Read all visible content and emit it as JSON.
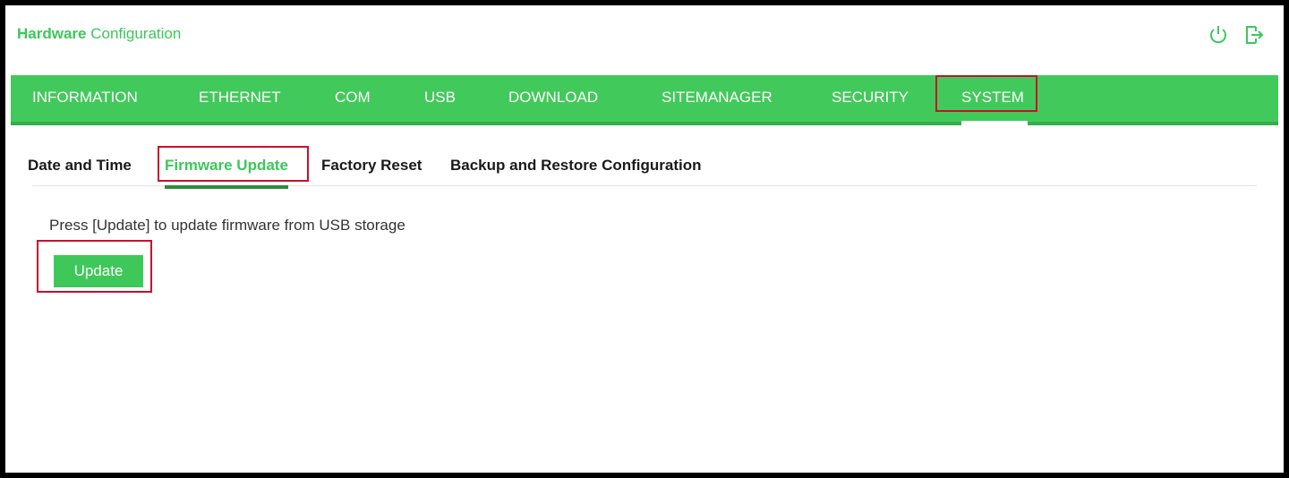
{
  "header": {
    "title_bold": "Hardware",
    "title_rest": " Configuration",
    "icons": [
      "power-icon",
      "logout-icon"
    ]
  },
  "nav": {
    "items": [
      "INFORMATION",
      "ETHERNET",
      "COM",
      "USB",
      "DOWNLOAD",
      "SITEMANAGER",
      "SECURITY",
      "SYSTEM"
    ],
    "active": "SYSTEM"
  },
  "subtabs": {
    "items": [
      "Date and Time",
      "Firmware Update",
      "Factory Reset",
      "Backup and Restore Configuration"
    ],
    "active": "Firmware Update"
  },
  "main": {
    "instruction": "Press [Update] to update firmware from USB storage",
    "button_label": "Update"
  },
  "colors": {
    "accent": "#42c95b",
    "accent_dark": "#2e8b3c",
    "highlight": "#c8102e"
  }
}
